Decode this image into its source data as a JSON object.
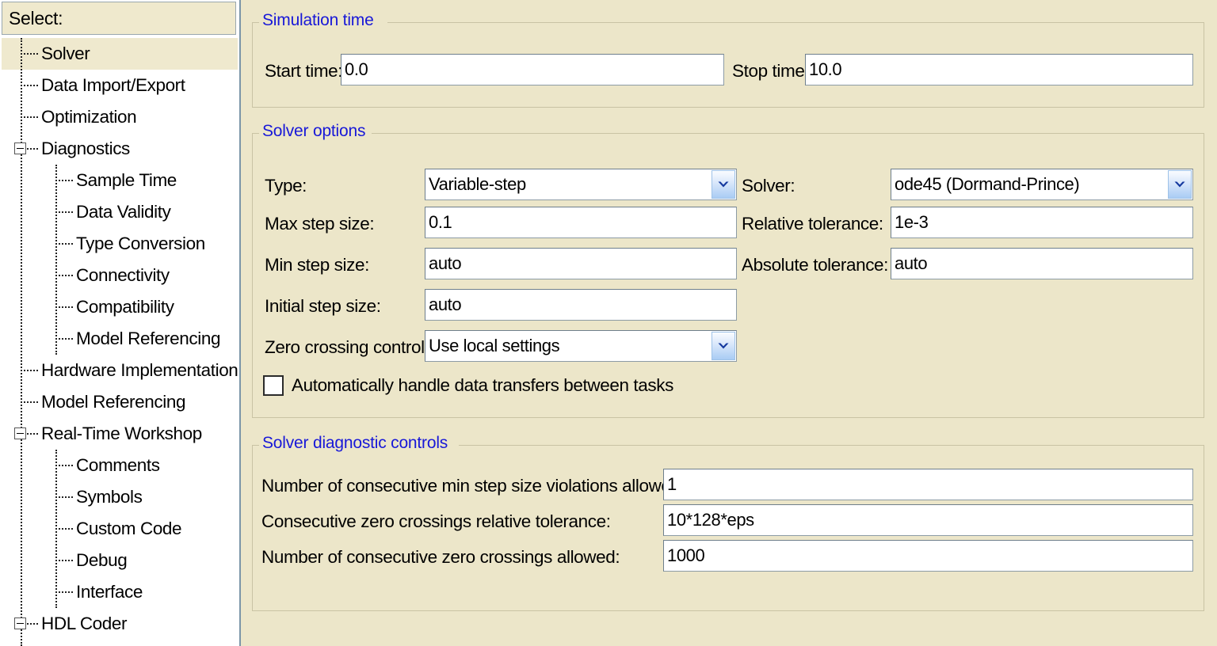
{
  "sidebar": {
    "header_label": "Select:",
    "items": [
      {
        "label": "Solver",
        "level": 1,
        "selected": true,
        "expander": false
      },
      {
        "label": "Data Import/Export",
        "level": 1,
        "selected": false,
        "expander": false
      },
      {
        "label": "Optimization",
        "level": 1,
        "selected": false,
        "expander": false
      },
      {
        "label": "Diagnostics",
        "level": 1,
        "selected": false,
        "expander": true
      },
      {
        "label": "Sample Time",
        "level": 2,
        "selected": false,
        "expander": false
      },
      {
        "label": "Data Validity",
        "level": 2,
        "selected": false,
        "expander": false
      },
      {
        "label": "Type Conversion",
        "level": 2,
        "selected": false,
        "expander": false
      },
      {
        "label": "Connectivity",
        "level": 2,
        "selected": false,
        "expander": false
      },
      {
        "label": "Compatibility",
        "level": 2,
        "selected": false,
        "expander": false
      },
      {
        "label": "Model Referencing",
        "level": 2,
        "selected": false,
        "expander": false
      },
      {
        "label": "Hardware Implementation",
        "level": 1,
        "selected": false,
        "expander": false
      },
      {
        "label": "Model Referencing",
        "level": 1,
        "selected": false,
        "expander": false
      },
      {
        "label": "Real-Time Workshop",
        "level": 1,
        "selected": false,
        "expander": true
      },
      {
        "label": "Comments",
        "level": 2,
        "selected": false,
        "expander": false
      },
      {
        "label": "Symbols",
        "level": 2,
        "selected": false,
        "expander": false
      },
      {
        "label": "Custom Code",
        "level": 2,
        "selected": false,
        "expander": false
      },
      {
        "label": "Debug",
        "level": 2,
        "selected": false,
        "expander": false
      },
      {
        "label": "Interface",
        "level": 2,
        "selected": false,
        "expander": false
      },
      {
        "label": "HDL Coder",
        "level": 1,
        "selected": false,
        "expander": true
      }
    ]
  },
  "simulation_time": {
    "group_title": "Simulation time",
    "start_time_label": "Start time:",
    "start_time_value": "0.0",
    "stop_time_label": "Stop time:",
    "stop_time_value": "10.0"
  },
  "solver_options": {
    "group_title": "Solver options",
    "type_label": "Type:",
    "type_value": "Variable-step",
    "solver_label": "Solver:",
    "solver_value": "ode45 (Dormand-Prince)",
    "max_step_label": "Max step size:",
    "max_step_value": "0.1",
    "relative_tolerance_label": "Relative tolerance:",
    "relative_tolerance_value": "1e-3",
    "min_step_label": "Min step size:",
    "min_step_value": "auto",
    "absolute_tolerance_label": "Absolute tolerance:",
    "absolute_tolerance_value": "auto",
    "initial_step_label": "Initial step size:",
    "initial_step_value": "auto",
    "zero_crossing_label": "Zero crossing control:",
    "zero_crossing_value": "Use local settings",
    "auto_data_transfers_label": "Automatically handle data transfers between tasks",
    "auto_data_transfers_checked": false
  },
  "solver_diagnostics": {
    "group_title": "Solver diagnostic controls",
    "min_step_violations_label": "Number of consecutive min step size violations allowed:",
    "min_step_violations_value": "1",
    "zero_cross_rel_tol_label": "Consecutive zero crossings relative tolerance:",
    "zero_cross_rel_tol_value": "10*128*eps",
    "zero_crossings_allowed_label": "Number of consecutive zero crossings allowed:",
    "zero_crossings_allowed_value": "1000"
  },
  "colors": {
    "panel_background": "#ECE6C9",
    "group_title": "#1818D8",
    "field_background": "#FFFFFF",
    "selection": "#EFE9CE",
    "tree_border": "#7B96A8"
  }
}
